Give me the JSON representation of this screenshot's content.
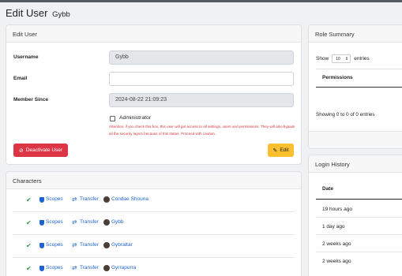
{
  "page": {
    "title": "Edit User",
    "subtitle": "Gybb"
  },
  "edit_user": {
    "header": "Edit User",
    "username_label": "Username",
    "username_value": "Gybb",
    "email_label": "Email",
    "email_value": "",
    "member_since_label": "Member Since",
    "member_since_value": "2024-08-22 21:09:23",
    "administrator_label": "Administrator",
    "warning_text": "Attention, if you check this box, this user will get access to all settings, users and permissions. They will also bypass all the security layers because of this status. Proceed with caution.",
    "deactivate_label": "Deactivate User",
    "edit_label": "Edit"
  },
  "characters": {
    "header": "Characters",
    "scopes_label": "Scopes",
    "transfer_label": "Transfer",
    "items": [
      {
        "name": "Condae Shouna"
      },
      {
        "name": "Gybb"
      },
      {
        "name": "Gybraltar"
      },
      {
        "name": "Gyrrapurra"
      }
    ]
  },
  "role_summary": {
    "header": "Role Summary",
    "show_label": "Show",
    "page_size": "10",
    "entries_label": "entries",
    "permissions_header": "Permissions",
    "info": "Showing 0 to 0 of 0 entries"
  },
  "login_history": {
    "header": "Login History",
    "date_header": "Date",
    "rows": [
      "19 hours ago",
      "1 day ago",
      "2 weeks ago",
      "2 weeks ago"
    ]
  },
  "colors": {
    "danger": "#dc3545",
    "warning": "#fbc02d",
    "link": "#1e64d0",
    "success": "#2e9e4c"
  }
}
